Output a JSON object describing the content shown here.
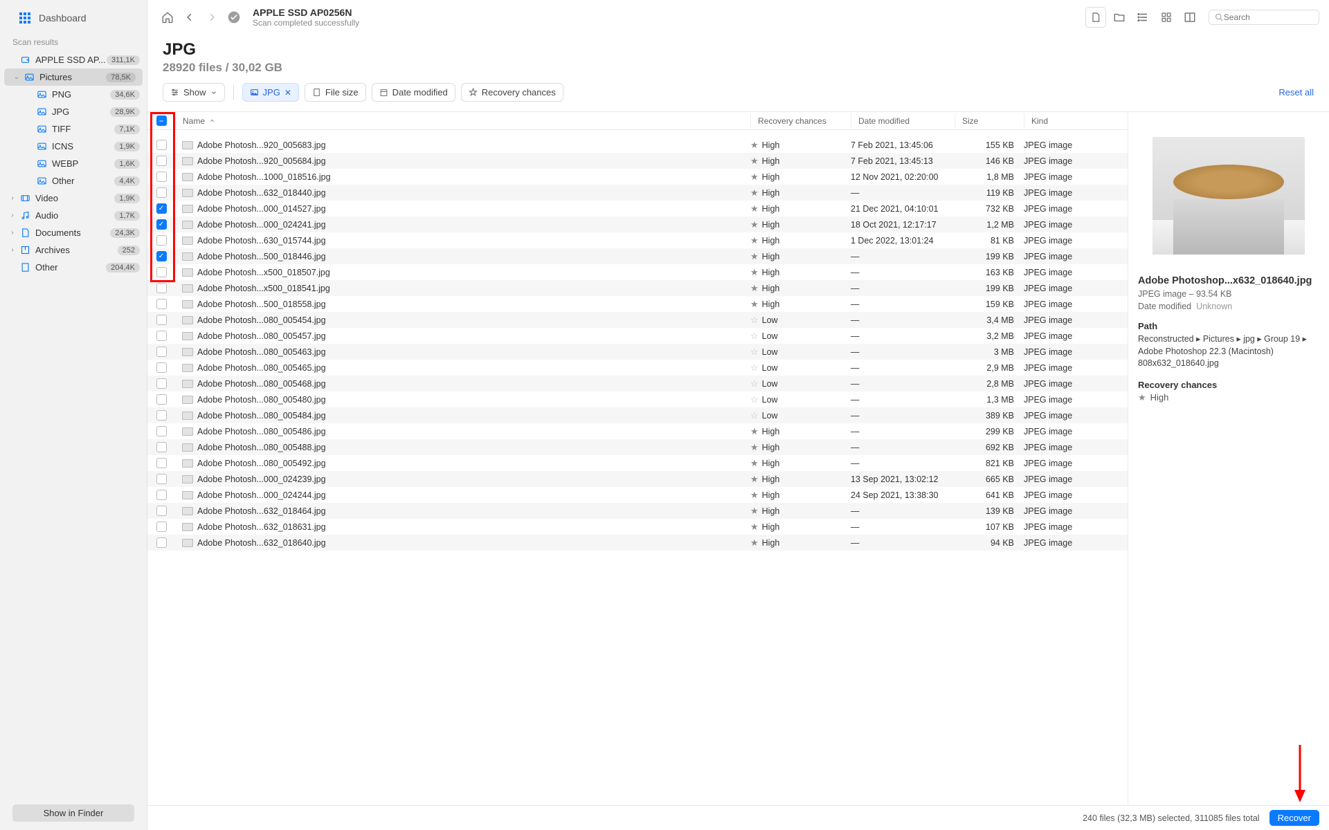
{
  "sidebar": {
    "dashboard": "Dashboard",
    "section_label": "Scan results",
    "items": [
      {
        "label": "APPLE SSD AP...",
        "badge": "311,1K",
        "icon": "disk",
        "chev": ""
      },
      {
        "label": "Pictures",
        "badge": "78,5K",
        "icon": "picture",
        "chev": "⌄",
        "selected": true
      },
      {
        "label": "PNG",
        "badge": "34,6K",
        "icon": "picture",
        "sub": true
      },
      {
        "label": "JPG",
        "badge": "28,9K",
        "icon": "picture",
        "sub": true
      },
      {
        "label": "TIFF",
        "badge": "7,1K",
        "icon": "picture",
        "sub": true
      },
      {
        "label": "ICNS",
        "badge": "1,9K",
        "icon": "picture",
        "sub": true
      },
      {
        "label": "WEBP",
        "badge": "1,6K",
        "icon": "picture",
        "sub": true
      },
      {
        "label": "Other",
        "badge": "4,4K",
        "icon": "picture",
        "sub": true
      },
      {
        "label": "Video",
        "badge": "1,9K",
        "icon": "video",
        "chev": "›"
      },
      {
        "label": "Audio",
        "badge": "1,7K",
        "icon": "audio",
        "chev": "›"
      },
      {
        "label": "Documents",
        "badge": "24,3K",
        "icon": "doc",
        "chev": "›"
      },
      {
        "label": "Archives",
        "badge": "252",
        "icon": "archive",
        "chev": "›"
      },
      {
        "label": "Other",
        "badge": "204,4K",
        "icon": "other",
        "chev": ""
      }
    ],
    "footer_btn": "Show in Finder"
  },
  "toolbar": {
    "title": "APPLE SSD AP0256N",
    "subtitle": "Scan completed successfully",
    "search_placeholder": "Search"
  },
  "heading": {
    "title": "JPG",
    "subtitle": "28920 files / 30,02 GB"
  },
  "filters": {
    "show": "Show",
    "jpg": "JPG",
    "filesize": "File size",
    "date": "Date modified",
    "recovery": "Recovery chances",
    "reset": "Reset all"
  },
  "columns": {
    "name": "Name",
    "recovery": "Recovery chances",
    "date": "Date modified",
    "size": "Size",
    "kind": "Kind"
  },
  "rows": [
    {
      "name": "Adobe Photosh...920_005683.jpg",
      "rec": "High",
      "date": "7 Feb 2021, 13:45:06",
      "size": "155 KB",
      "kind": "JPEG image",
      "chk": false
    },
    {
      "name": "Adobe Photosh...920_005684.jpg",
      "rec": "High",
      "date": "7 Feb 2021, 13:45:13",
      "size": "146 KB",
      "kind": "JPEG image",
      "chk": false
    },
    {
      "name": "Adobe Photosh...1000_018516.jpg",
      "rec": "High",
      "date": "12 Nov 2021, 02:20:00",
      "size": "1,8 MB",
      "kind": "JPEG image",
      "chk": false
    },
    {
      "name": "Adobe Photosh...632_018440.jpg",
      "rec": "High",
      "date": "—",
      "size": "119 KB",
      "kind": "JPEG image",
      "chk": false
    },
    {
      "name": "Adobe Photosh...000_014527.jpg",
      "rec": "High",
      "date": "21 Dec 2021, 04:10:01",
      "size": "732 KB",
      "kind": "JPEG image",
      "chk": true
    },
    {
      "name": "Adobe Photosh...000_024241.jpg",
      "rec": "High",
      "date": "18 Oct 2021, 12:17:17",
      "size": "1,2 MB",
      "kind": "JPEG image",
      "chk": true
    },
    {
      "name": "Adobe Photosh...630_015744.jpg",
      "rec": "High",
      "date": "1 Dec 2022, 13:01:24",
      "size": "81 KB",
      "kind": "JPEG image",
      "chk": false
    },
    {
      "name": "Adobe Photosh...500_018446.jpg",
      "rec": "High",
      "date": "—",
      "size": "199 KB",
      "kind": "JPEG image",
      "chk": true
    },
    {
      "name": "Adobe Photosh...x500_018507.jpg",
      "rec": "High",
      "date": "—",
      "size": "163 KB",
      "kind": "JPEG image",
      "chk": false
    },
    {
      "name": "Adobe Photosh...x500_018541.jpg",
      "rec": "High",
      "date": "—",
      "size": "199 KB",
      "kind": "JPEG image",
      "chk": false
    },
    {
      "name": "Adobe Photosh...500_018558.jpg",
      "rec": "High",
      "date": "—",
      "size": "159 KB",
      "kind": "JPEG image",
      "chk": false
    },
    {
      "name": "Adobe Photosh...080_005454.jpg",
      "rec": "Low",
      "date": "—",
      "size": "3,4 MB",
      "kind": "JPEG image",
      "chk": false
    },
    {
      "name": "Adobe Photosh...080_005457.jpg",
      "rec": "Low",
      "date": "—",
      "size": "3,2 MB",
      "kind": "JPEG image",
      "chk": false
    },
    {
      "name": "Adobe Photosh...080_005463.jpg",
      "rec": "Low",
      "date": "—",
      "size": "3 MB",
      "kind": "JPEG image",
      "chk": false
    },
    {
      "name": "Adobe Photosh...080_005465.jpg",
      "rec": "Low",
      "date": "—",
      "size": "2,9 MB",
      "kind": "JPEG image",
      "chk": false
    },
    {
      "name": "Adobe Photosh...080_005468.jpg",
      "rec": "Low",
      "date": "—",
      "size": "2,8 MB",
      "kind": "JPEG image",
      "chk": false
    },
    {
      "name": "Adobe Photosh...080_005480.jpg",
      "rec": "Low",
      "date": "—",
      "size": "1,3 MB",
      "kind": "JPEG image",
      "chk": false
    },
    {
      "name": "Adobe Photosh...080_005484.jpg",
      "rec": "Low",
      "date": "—",
      "size": "389 KB",
      "kind": "JPEG image",
      "chk": false
    },
    {
      "name": "Adobe Photosh...080_005486.jpg",
      "rec": "High",
      "date": "—",
      "size": "299 KB",
      "kind": "JPEG image",
      "chk": false
    },
    {
      "name": "Adobe Photosh...080_005488.jpg",
      "rec": "High",
      "date": "—",
      "size": "692 KB",
      "kind": "JPEG image",
      "chk": false
    },
    {
      "name": "Adobe Photosh...080_005492.jpg",
      "rec": "High",
      "date": "—",
      "size": "821 KB",
      "kind": "JPEG image",
      "chk": false
    },
    {
      "name": "Adobe Photosh...000_024239.jpg",
      "rec": "High",
      "date": "13 Sep 2021, 13:02:12",
      "size": "665 KB",
      "kind": "JPEG image",
      "chk": false
    },
    {
      "name": "Adobe Photosh...000_024244.jpg",
      "rec": "High",
      "date": "24 Sep 2021, 13:38:30",
      "size": "641 KB",
      "kind": "JPEG image",
      "chk": false
    },
    {
      "name": "Adobe Photosh...632_018464.jpg",
      "rec": "High",
      "date": "—",
      "size": "139 KB",
      "kind": "JPEG image",
      "chk": false
    },
    {
      "name": "Adobe Photosh...632_018631.jpg",
      "rec": "High",
      "date": "—",
      "size": "107 KB",
      "kind": "JPEG image",
      "chk": false
    },
    {
      "name": "Adobe Photosh...632_018640.jpg",
      "rec": "High",
      "date": "—",
      "size": "94 KB",
      "kind": "JPEG image",
      "chk": false
    }
  ],
  "detail": {
    "title": "Adobe Photoshop...x632_018640.jpg",
    "kind_size": "JPEG image – 93.54 KB",
    "date_label": "Date modified",
    "date_value": "Unknown",
    "path_label": "Path",
    "path_value": "Reconstructed ▸ Pictures ▸ jpg ▸ Group 19 ▸ Adobe Photoshop 22.3 (Macintosh) 808x632_018640.jpg",
    "rc_label": "Recovery chances",
    "rc_value": "High"
  },
  "status": {
    "summary": "240 files (32,3 MB) selected, 311085 files total",
    "recover": "Recover"
  }
}
